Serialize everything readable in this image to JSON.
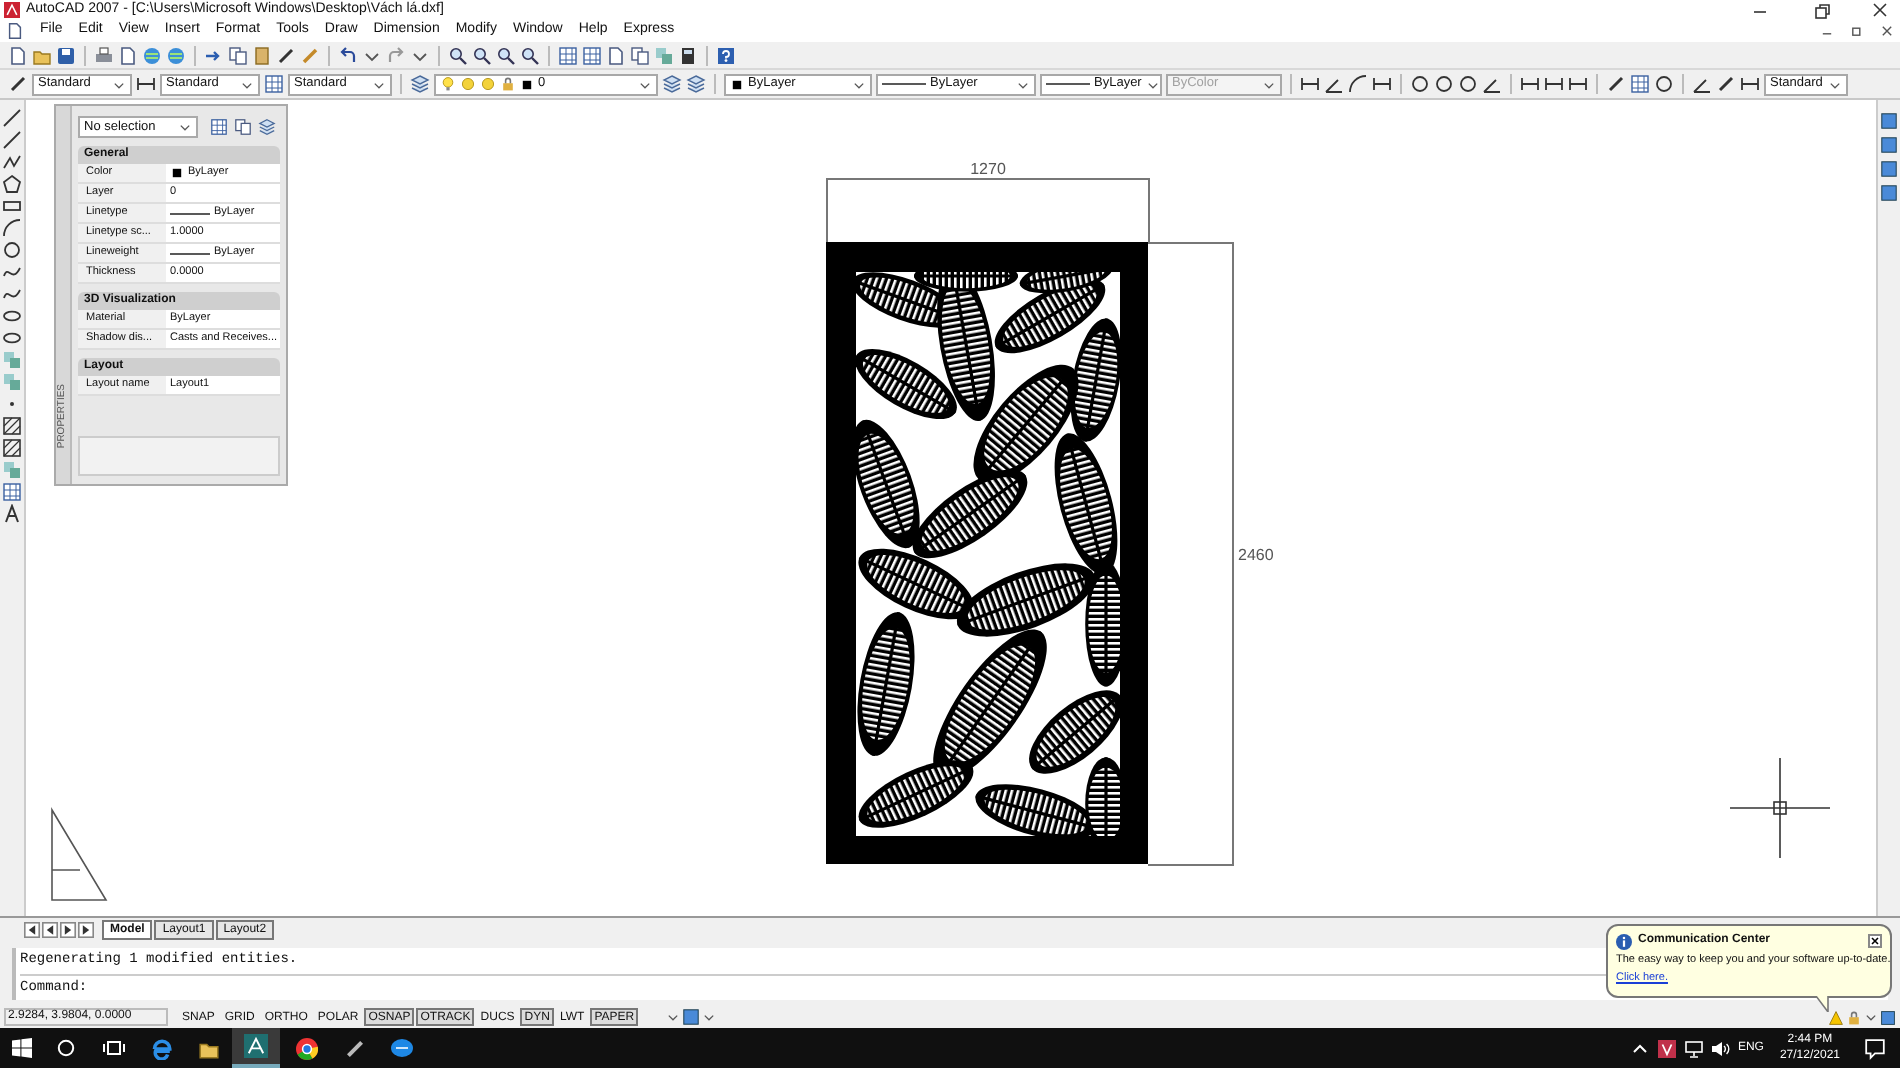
{
  "window": {
    "title": "AutoCAD 2007 - [C:\\Users\\Microsoft Windows\\Desktop\\Vách lá.dxf]"
  },
  "menu": [
    "File",
    "Edit",
    "View",
    "Insert",
    "Format",
    "Tools",
    "Draw",
    "Dimension",
    "Modify",
    "Window",
    "Help",
    "Express"
  ],
  "style_toolbar": [
    {
      "kind": "plain",
      "value": "Standard",
      "disabled": false
    },
    {
      "kind": "plain",
      "value": "Standard",
      "disabled": false
    },
    {
      "kind": "plain",
      "value": "Standard",
      "disabled": false
    },
    {
      "kind": "layer",
      "value": "0",
      "disabled": false
    },
    {
      "kind": "color",
      "value": "ByLayer",
      "disabled": false
    },
    {
      "kind": "line",
      "value": "ByLayer",
      "disabled": false
    },
    {
      "kind": "line",
      "value": "ByLayer",
      "disabled": false
    },
    {
      "kind": "plain",
      "value": "ByColor",
      "disabled": true
    },
    {
      "kind": "plain",
      "value": "Standard",
      "disabled": false
    }
  ],
  "properties": {
    "tab_label": "PROPERTIES",
    "selection": "No selection",
    "sections": [
      {
        "title": "General",
        "rows": [
          {
            "label": "Color",
            "value": "ByLayer",
            "kind": "color"
          },
          {
            "label": "Layer",
            "value": "0",
            "kind": "text"
          },
          {
            "label": "Linetype",
            "value": "ByLayer",
            "kind": "line"
          },
          {
            "label": "Linetype sc...",
            "value": "1.0000",
            "kind": "text"
          },
          {
            "label": "Lineweight",
            "value": "ByLayer",
            "kind": "line"
          },
          {
            "label": "Thickness",
            "value": "0.0000",
            "kind": "text"
          }
        ]
      },
      {
        "title": "3D Visualization",
        "rows": [
          {
            "label": "Material",
            "value": "ByLayer",
            "kind": "text"
          },
          {
            "label": "Shadow dis...",
            "value": "Casts and Receives...",
            "kind": "text"
          }
        ]
      },
      {
        "title": "Layout",
        "rows": [
          {
            "label": "Layout name",
            "value": "Layout1",
            "kind": "text"
          }
        ]
      }
    ]
  },
  "drawing": {
    "width_dimension": "1270",
    "height_dimension": "2460"
  },
  "layout_tabs": [
    {
      "label": "Model",
      "selected": true
    },
    {
      "label": "Layout1",
      "selected": false
    },
    {
      "label": "Layout2",
      "selected": false
    }
  ],
  "command_history": [
    "Regenerating 1 modified entities."
  ],
  "command_prompt": "Command:",
  "status_bar": {
    "coordinates": "2.9284, 3.9804, 0.0000",
    "toggles": [
      {
        "label": "SNAP",
        "on": false
      },
      {
        "label": "GRID",
        "on": false
      },
      {
        "label": "ORTHO",
        "on": false
      },
      {
        "label": "POLAR",
        "on": false
      },
      {
        "label": "OSNAP",
        "on": true
      },
      {
        "label": "OTRACK",
        "on": true
      },
      {
        "label": "DUCS",
        "on": false
      },
      {
        "label": "DYN",
        "on": true
      },
      {
        "label": "LWT",
        "on": false
      },
      {
        "label": "PAPER",
        "on": true
      }
    ]
  },
  "notification": {
    "title": "Communication Center",
    "message": "The easy way to keep you and your software up-to-date.",
    "link": "Click here."
  },
  "taskbar": {
    "language": "ENG",
    "time": "2:44 PM",
    "date": "27/12/2021"
  }
}
